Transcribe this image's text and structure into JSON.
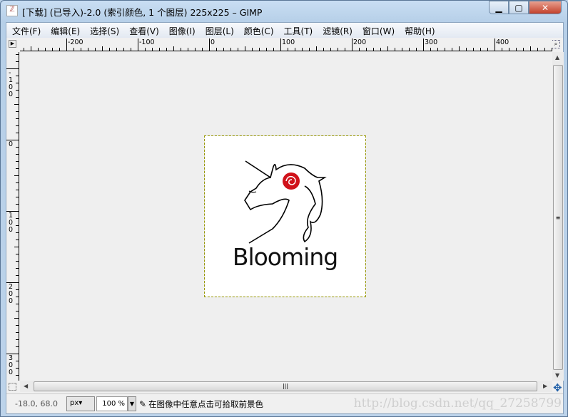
{
  "window": {
    "title": "[下载] (已导入)-2.0 (索引颜色, 1 个图层) 225x225 – GIMP",
    "app_icon": "gimp-icon",
    "minimize": "minimize",
    "maximize": "maximize",
    "close": "close"
  },
  "menu": [
    "文件(F)",
    "编辑(E)",
    "选择(S)",
    "查看(V)",
    "图像(I)",
    "图层(L)",
    "颜色(C)",
    "工具(T)",
    "滤镜(R)",
    "窗口(W)",
    "帮助(H)"
  ],
  "ruler_top": {
    "labels": [
      -200,
      -100,
      0,
      100,
      200,
      300,
      400
    ],
    "range": [
      -265,
      480
    ]
  },
  "ruler_left": {
    "labels": [
      -100,
      0,
      100,
      200,
      300
    ],
    "range": [
      -123,
      338
    ]
  },
  "image": {
    "logo_text": "Blooming",
    "accent_rose": "#d0121a"
  },
  "status": {
    "coords": "-18.0, 68.0",
    "unit": "px",
    "zoom": "100 %",
    "message": "在图像中任意点击可拾取前景色",
    "watermark": "http://blog.csdn.net/qq_27258799"
  }
}
